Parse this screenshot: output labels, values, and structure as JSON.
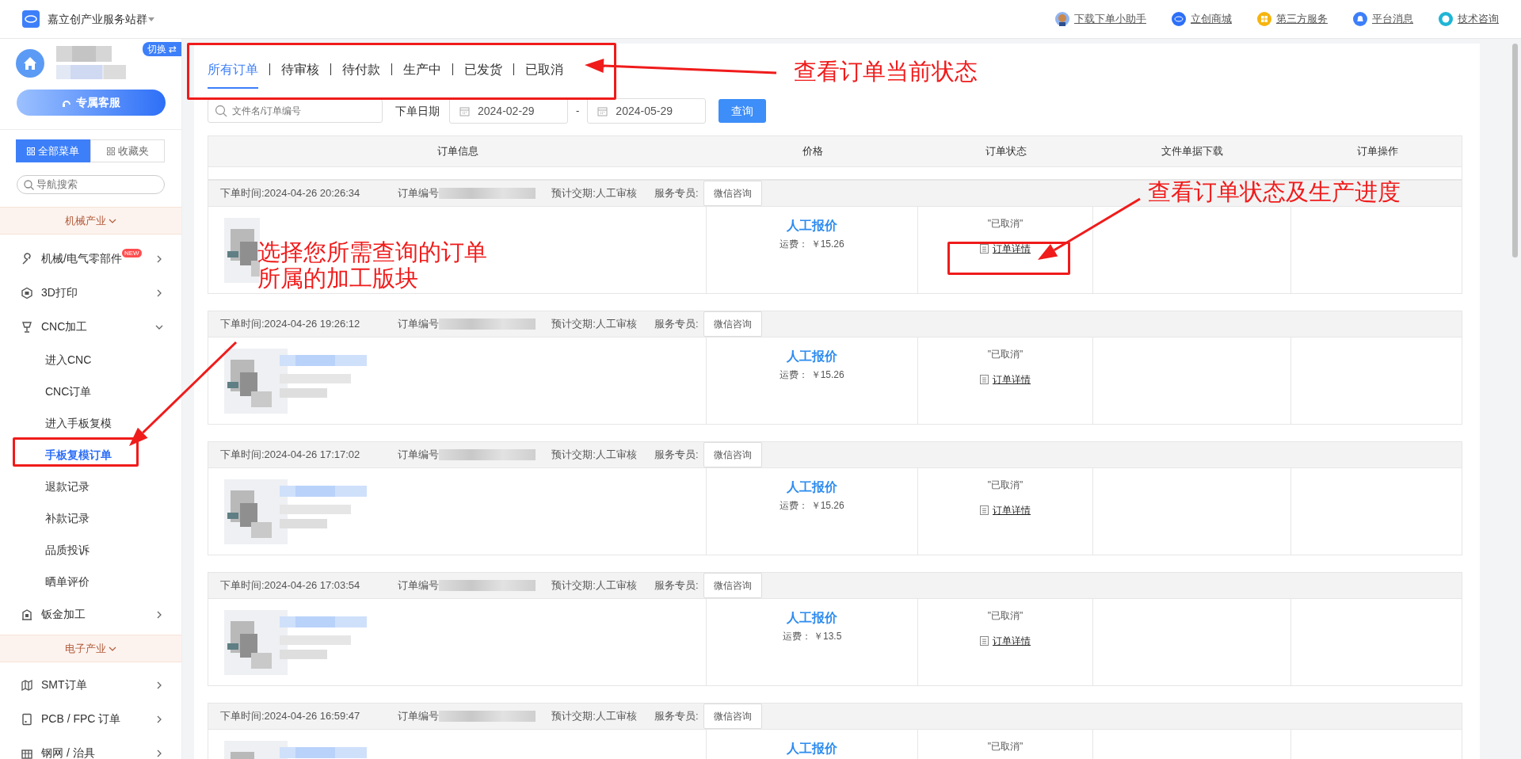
{
  "topbar": {
    "title": "嘉立创产业服务站群",
    "links": [
      {
        "label": "下载下单小助手"
      },
      {
        "label": "立创商城"
      },
      {
        "label": "第三方服务"
      },
      {
        "label": "平台消息"
      },
      {
        "label": "技术咨询"
      }
    ]
  },
  "sidebar": {
    "switch_label": "切换 ⇄",
    "service_button": "专属客服",
    "menu_tabs": [
      {
        "label": "全部菜单",
        "selected": true
      },
      {
        "label": "收藏夹",
        "selected": false
      }
    ],
    "search": {
      "placeholder": "导航搜索"
    },
    "groups": [
      {
        "title": "机械产业",
        "items": [
          {
            "label": "机械/电气零部件",
            "badge": "NEW",
            "expanded": false
          },
          {
            "label": "3D打印",
            "expanded": false
          },
          {
            "label": "CNC加工",
            "expanded": true,
            "children": [
              {
                "label": "进入CNC",
                "selected": false
              },
              {
                "label": "CNC订单",
                "selected": false
              },
              {
                "label": "进入手板复模",
                "selected": false
              },
              {
                "label": "手板复模订单",
                "selected": true
              },
              {
                "label": "退款记录",
                "selected": false
              },
              {
                "label": "补款记录",
                "selected": false
              },
              {
                "label": "品质投诉",
                "selected": false
              },
              {
                "label": "晒单评价",
                "selected": false
              }
            ]
          },
          {
            "label": "钣金加工",
            "expanded": false
          }
        ]
      },
      {
        "title": "电子产业",
        "items": [
          {
            "label": "SMT订单",
            "expanded": false
          },
          {
            "label": "PCB / FPC 订单",
            "expanded": false
          },
          {
            "label": "钢网 / 治具",
            "expanded": false
          }
        ]
      }
    ]
  },
  "tabs": [
    {
      "label": "所有订单",
      "selected": true
    },
    {
      "label": "待审核",
      "selected": false
    },
    {
      "label": "待付款",
      "selected": false
    },
    {
      "label": "生产中",
      "selected": false
    },
    {
      "label": "已发货",
      "selected": false
    },
    {
      "label": "已取消",
      "selected": false
    }
  ],
  "filters": {
    "search": {
      "placeholder": "文件名/订单编号"
    },
    "date_label": "下单日期",
    "start_date": "2024-02-29",
    "separator": "-",
    "end_date": "2024-05-29",
    "query_button": "查询"
  },
  "table": {
    "columns": [
      "订单信息",
      "价格",
      "订单状态",
      "文件单据下载",
      "订单操作"
    ],
    "orders": [
      {
        "time": "下单时间:2024-04-26 20:26:34",
        "number_label": "订单编号",
        "delivery": "预计交期:人工审核",
        "agent_label": "服务专员:",
        "contact_button": "微信咨询",
        "price": "人工报价",
        "freight": "运费： ￥15.26",
        "status": "\"已取消\"",
        "details_link": "订单详情"
      },
      {
        "time": "下单时间:2024-04-26 19:26:12",
        "number_label": "订单编号",
        "delivery": "预计交期:人工审核",
        "agent_label": "服务专员:",
        "contact_button": "微信咨询",
        "price": "人工报价",
        "freight": "运费： ￥15.26",
        "status": "\"已取消\"",
        "details_link": "订单详情"
      },
      {
        "time": "下单时间:2024-04-26 17:17:02",
        "number_label": "订单编号",
        "delivery": "预计交期:人工审核",
        "agent_label": "服务专员:",
        "contact_button": "微信咨询",
        "price": "人工报价",
        "freight": "运费： ￥15.26",
        "status": "\"已取消\"",
        "details_link": "订单详情"
      },
      {
        "time": "下单时间:2024-04-26 17:03:54",
        "number_label": "订单编号",
        "delivery": "预计交期:人工审核",
        "agent_label": "服务专员:",
        "contact_button": "微信咨询",
        "price": "人工报价",
        "freight": "运费： ￥13.5",
        "status": "\"已取消\"",
        "details_link": "订单详情"
      },
      {
        "time": "下单时间:2024-04-26 16:59:47",
        "number_label": "订单编号",
        "delivery": "预计交期:人工审核",
        "agent_label": "服务专员:",
        "contact_button": "微信咨询",
        "price": "人工报价",
        "status": "\"已取消\""
      }
    ]
  },
  "annotations": [
    {
      "kind": "box"
    },
    {
      "kind": "arrow"
    },
    {
      "kind": "note",
      "text": "查看订单当前状态"
    },
    {
      "kind": "box"
    },
    {
      "kind": "arrow"
    },
    {
      "kind": "note",
      "text": "查看订单状态及生产进度"
    },
    {
      "kind": "box"
    },
    {
      "kind": "arrow"
    },
    {
      "kind": "note",
      "text": "选择您所需查询的订单所属的加工版块"
    }
  ]
}
